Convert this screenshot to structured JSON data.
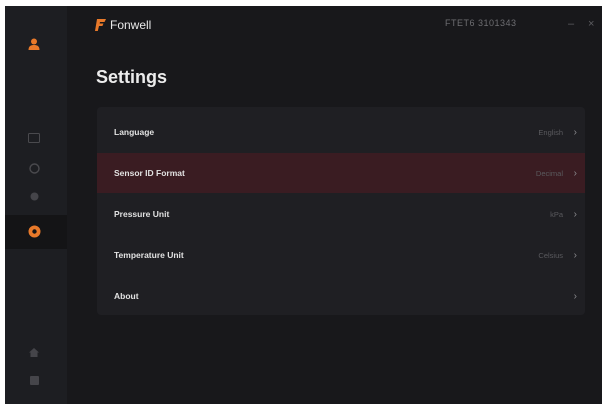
{
  "app": {
    "brand": "Fonwell"
  },
  "header": {
    "info": "FTET6 3101343",
    "minimize": "–",
    "close": "×"
  },
  "page": {
    "title": "Settings"
  },
  "settings": [
    {
      "label": "Language",
      "value": "English"
    },
    {
      "label": "Sensor ID Format",
      "value": "Decimal"
    },
    {
      "label": "Pressure Unit",
      "value": "kPa"
    },
    {
      "label": "Temperature Unit",
      "value": "Celsius"
    },
    {
      "label": "About",
      "value": ""
    }
  ],
  "sidebar": {
    "items": [
      "user-icon",
      "device-icon",
      "tire-icon",
      "tool-icon",
      "settings-icon",
      "home-icon",
      "exit-icon"
    ],
    "active": "settings-icon"
  },
  "colors": {
    "accent": "#e8792a",
    "background": "#18181b",
    "card": "#1f1f23",
    "highlight_row": "#3a1c22"
  }
}
